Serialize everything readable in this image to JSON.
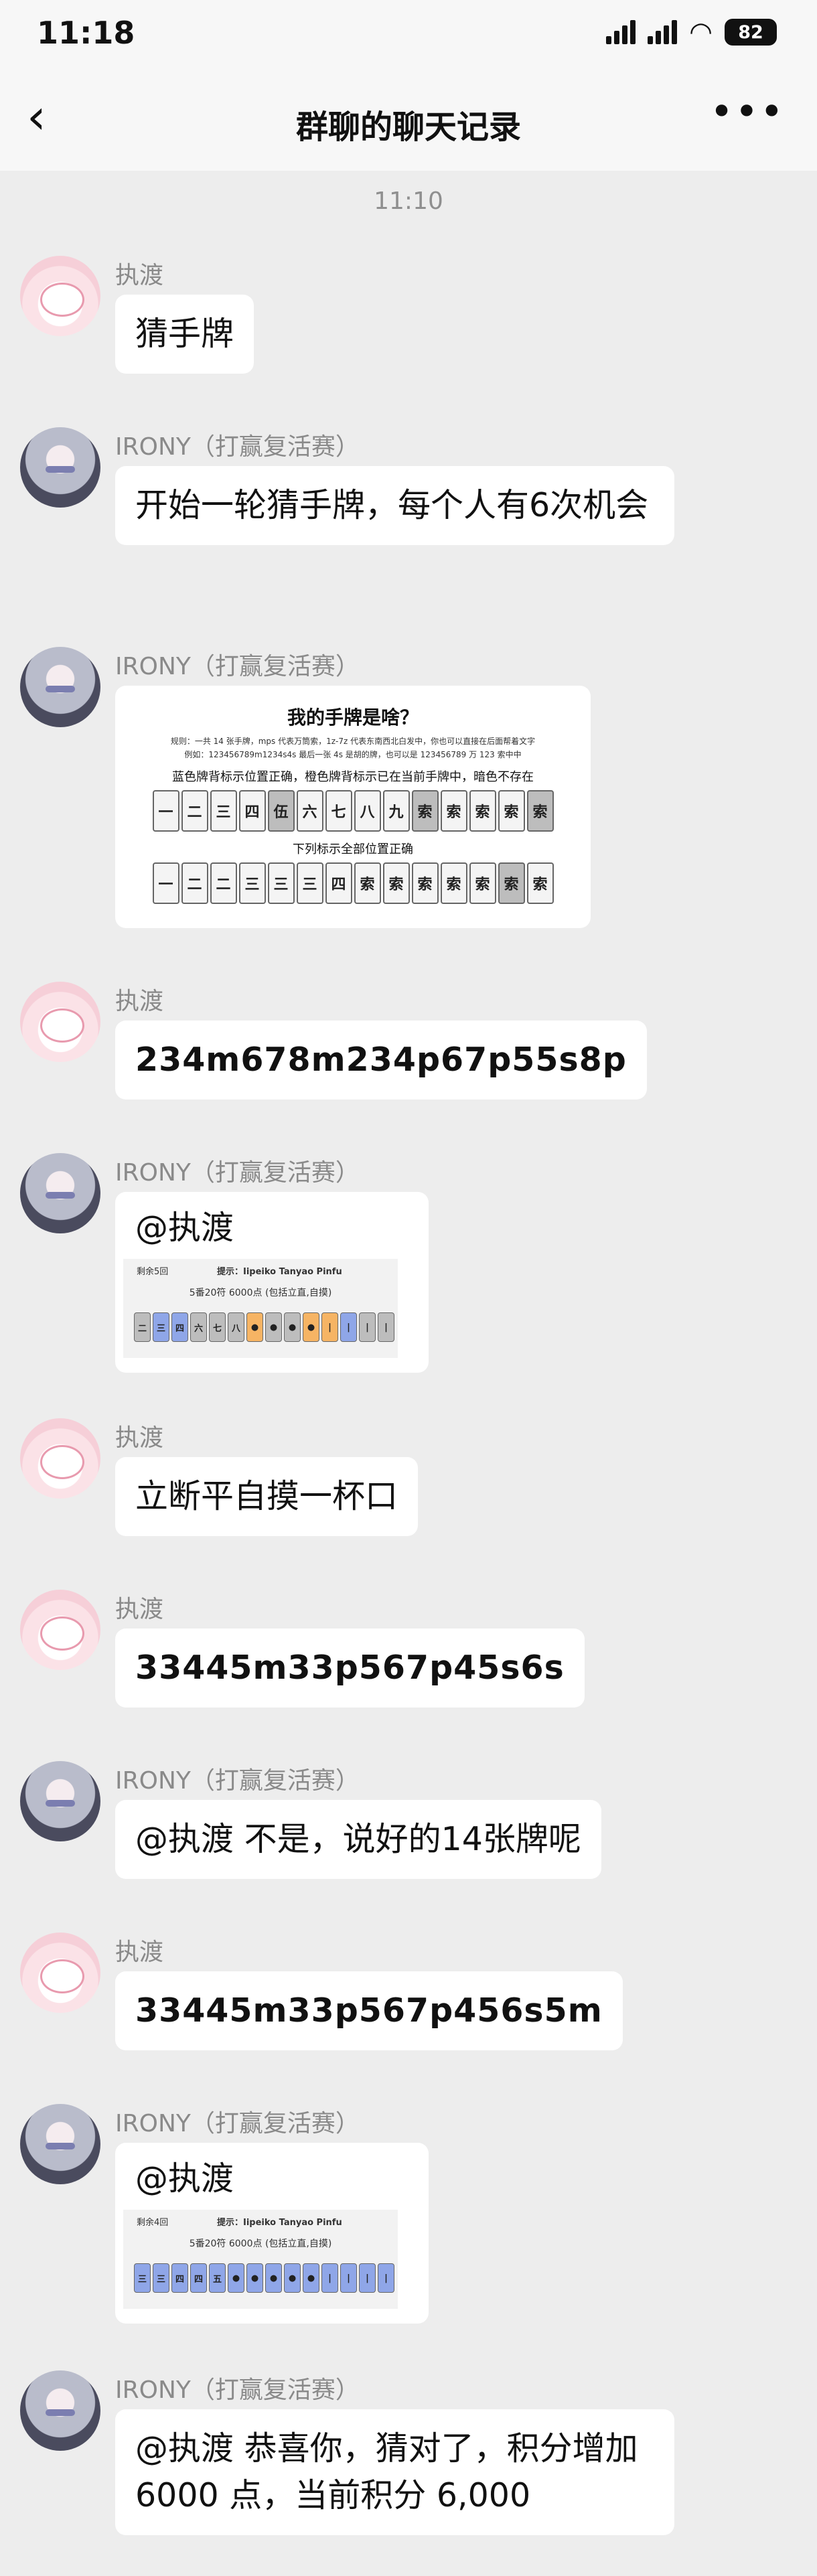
{
  "status": {
    "time": "11:18",
    "battery": "82"
  },
  "nav": {
    "title": "群聊的聊天记录",
    "back_icon": "‹",
    "more_icon": "•••"
  },
  "timestamp": "11:10",
  "messages": {
    "m1": {
      "sender": "执渡",
      "text": "猜手牌"
    },
    "m2": {
      "sender": "IRONY（打赢复活赛）",
      "text": "开始一轮猜手牌，每个人有6次机会"
    },
    "m3": {
      "sender": "IRONY（打赢复活赛）",
      "card": {
        "title": "我的手牌是啥？",
        "rule_line1": "规则：一共 14 张手牌，mps 代表万筒索，1z-7z 代表东南西北白发中，你也可以直接在后面帮着文字",
        "rule_line2": "例如：123456789m1234s4s  最后一张 4s 是胡的牌，也可以是 123456789 万 123 索中中",
        "legend": "蓝色牌背标示位置正确，橙色牌背标示已在当前手牌中，暗色不存在",
        "guess_label": "下列标示全部位置正确"
      }
    },
    "m4": {
      "sender": "执渡",
      "text": "234m678m234p67p55s8p"
    },
    "m5": {
      "sender": "IRONY（打赢复活赛）",
      "text": "@执渡",
      "card": {
        "remaining": "剩余5回",
        "hint": "提示：Iipeiko Tanyao Pinfu",
        "score_line": "5番20符 6000点 (包括立直,自摸)"
      }
    },
    "m6": {
      "sender": "执渡",
      "text": "立断平自摸一杯口"
    },
    "m7": {
      "sender": "执渡",
      "text": "33445m33p567p45s6s"
    },
    "m8": {
      "sender": "IRONY（打赢复活赛）",
      "text": "@执渡 不是，说好的14张牌呢"
    },
    "m9": {
      "sender": "执渡",
      "text": "33445m33p567p456s5m"
    },
    "m10": {
      "sender": "IRONY（打赢复活赛）",
      "text": "@执渡",
      "card": {
        "remaining": "剩余4回",
        "hint": "提示：Iipeiko Tanyao Pinfu",
        "score_line": "5番20符 6000点 (包括立直,自摸)"
      }
    },
    "m11": {
      "sender": "IRONY（打赢复活赛）",
      "text": "@执渡 恭喜你，猜对了，积分增加 6000 点，当前积分 6,000"
    }
  },
  "tiles": {
    "row1": [
      "一",
      "二",
      "三",
      "四",
      "伍",
      "六",
      "七",
      "八",
      "九",
      "索",
      "索",
      "索",
      "索",
      "索"
    ],
    "row2": [
      "一",
      "二",
      "二",
      "三",
      "三",
      "三",
      "四",
      "索",
      "索",
      "索",
      "索",
      "索",
      "索",
      "索"
    ],
    "row3": [
      "二",
      "三",
      "四",
      "六",
      "七",
      "八",
      "●",
      "●",
      "●",
      "●",
      "|",
      "|",
      "|",
      "|"
    ],
    "row4": [
      "三",
      "三",
      "四",
      "四",
      "五",
      "●",
      "●",
      "●",
      "●",
      "●",
      "|",
      "|",
      "|",
      "|"
    ]
  },
  "colors": {
    "bg": "#ededed",
    "bubble": "#ffffff",
    "blue_tile": "#8fa6e8",
    "orange_tile": "#f6b464"
  }
}
